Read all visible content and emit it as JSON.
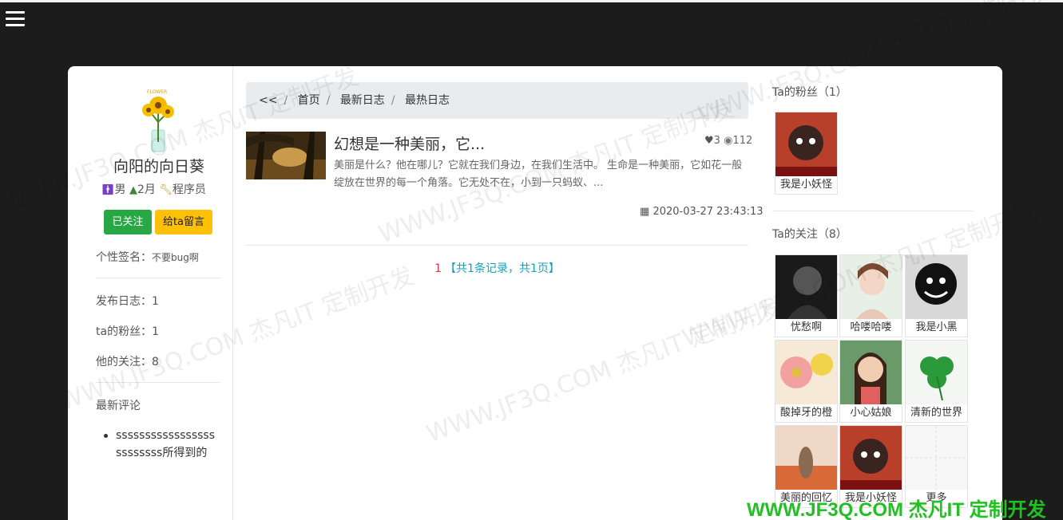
{
  "nav": {
    "menu_icon": "hamburger-icon"
  },
  "profile": {
    "name": "向阳的向日葵",
    "gender": "男",
    "age": "2月",
    "job": "程序员",
    "follow_label": "已关注",
    "message_label": "给ta留言",
    "signature_label": "个性签名：",
    "signature_value": "不要bug啊",
    "stats": [
      "发布日志：1",
      "ta的粉丝：1",
      "他的关注：8"
    ],
    "latest_comments_label": "最新评论",
    "comment": "sssssssssssssssssssssssss所得到的"
  },
  "breadcrumb": {
    "back": "<<",
    "items": [
      "首页",
      "最新日志",
      "最热日志"
    ]
  },
  "post": {
    "title": "幻想是一种美丽，它...",
    "likes": "3",
    "views": "112",
    "excerpt": "美丽是什么？他在哪儿？它就在我们身边，在我们生活中。 生命是一种美丽，它如花一般绽放在世界的每一个角落。它无处不在，小到一只蚂蚁、...",
    "date": "2020-03-27 23:43:13"
  },
  "pager": {
    "current": "1",
    "summary": "【共1条记录，共1页】"
  },
  "fans": {
    "title": "Ta的粉丝（1）",
    "items": [
      "我是小妖怪"
    ]
  },
  "following": {
    "title": "Ta的关注（8）",
    "items": [
      "忧愁啊",
      "哈喽哈喽",
      "我是小黑",
      "酸掉牙的橙",
      "小心姑娘",
      "清新的世界",
      "美丽的回忆",
      "我是小妖怪",
      "更多"
    ]
  },
  "watermark": {
    "text": "WWW.JF3Q.COM 杰凡IT 定制开发",
    "footer": "WWW.JF3Q.COM 杰凡IT  定制开发"
  },
  "colors": {
    "success": "#28a745",
    "warning": "#ffc107",
    "info": "#17a2b8",
    "danger": "#dc3545"
  }
}
